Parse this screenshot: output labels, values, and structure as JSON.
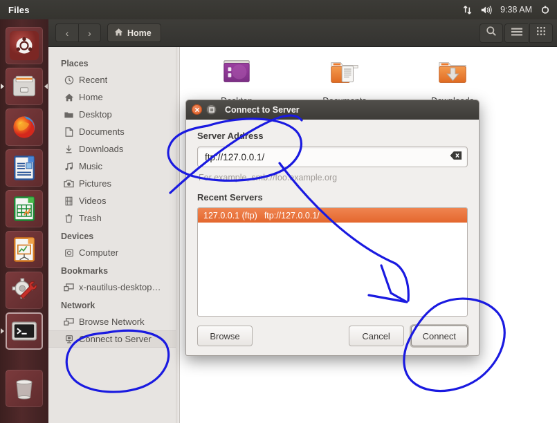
{
  "top_panel": {
    "app_name": "Files",
    "indicators": [
      {
        "name": "network-indicator",
        "glyph": "network"
      },
      {
        "name": "volume-indicator",
        "glyph": "speaker"
      }
    ],
    "clock": "9:38 AM",
    "session_indicator": "power-gear"
  },
  "launcher": {
    "items": [
      {
        "name": "ubuntu-dash",
        "label": "Ubuntu Dash"
      },
      {
        "name": "files",
        "label": "Files"
      },
      {
        "name": "firefox",
        "label": "Firefox Web Browser"
      },
      {
        "name": "libreoffice-writer",
        "label": "LibreOffice Writer"
      },
      {
        "name": "libreoffice-calc",
        "label": "LibreOffice Calc"
      },
      {
        "name": "libreoffice-impress",
        "label": "LibreOffice Impress"
      },
      {
        "name": "system-settings",
        "label": "System Settings"
      },
      {
        "name": "terminal",
        "label": "Terminal"
      }
    ],
    "trash": {
      "name": "trash",
      "label": "Trash"
    }
  },
  "window": {
    "toolbar": {
      "back_label": "‹",
      "forward_label": "›",
      "breadcrumb": "Home",
      "search_icon": "search-icon",
      "menu_icon": "hamburger-menu-icon",
      "view_icon": "grid-view-icon"
    },
    "sidebar": {
      "sections": [
        {
          "title": "Places",
          "items": [
            {
              "label": "Recent",
              "icon": "clock-icon"
            },
            {
              "label": "Home",
              "icon": "home-icon"
            },
            {
              "label": "Desktop",
              "icon": "folder-icon"
            },
            {
              "label": "Documents",
              "icon": "document-icon"
            },
            {
              "label": "Downloads",
              "icon": "download-icon"
            },
            {
              "label": "Music",
              "icon": "music-note-icon"
            },
            {
              "label": "Pictures",
              "icon": "camera-icon"
            },
            {
              "label": "Videos",
              "icon": "film-icon"
            },
            {
              "label": "Trash",
              "icon": "trash-icon"
            }
          ]
        },
        {
          "title": "Devices",
          "items": [
            {
              "label": "Computer",
              "icon": "computer-icon"
            }
          ]
        },
        {
          "title": "Bookmarks",
          "items": [
            {
              "label": "x-nautilus-desktop…",
              "icon": "desktop-icon"
            }
          ]
        },
        {
          "title": "Network",
          "items": [
            {
              "label": "Browse Network",
              "icon": "network-icon"
            },
            {
              "label": "Connect to Server",
              "icon": "server-icon",
              "highlighted": true
            }
          ]
        }
      ]
    },
    "files": [
      {
        "label": "Desktop",
        "icon": "desktop-folder-icon"
      },
      {
        "label": "Documents",
        "icon": "documents-folder-icon"
      },
      {
        "label": "Downloads",
        "icon": "downloads-folder-icon"
      }
    ]
  },
  "dialog": {
    "title": "Connect to Server",
    "close_icon": "close-icon",
    "maximize_icon": "maximize-icon",
    "server_address_label": "Server Address",
    "server_address_value": "ftp://127.0.0.1/",
    "clear_icon": "clear-entry-icon",
    "hint": "For example, smb://foo.example.org",
    "recent_servers_label": "Recent Servers",
    "recent_servers": [
      {
        "name": "127.0.0.1 (ftp)",
        "uri": "ftp://127.0.0.1/",
        "selected": true
      }
    ],
    "browse_label": "Browse",
    "cancel_label": "Cancel",
    "connect_label": "Connect"
  },
  "colors": {
    "selection_orange": "#e4672e",
    "launcher_maroon": "#4a2526",
    "panel_dark": "#3c3b37",
    "annotation_blue": "#1a1ae0"
  }
}
